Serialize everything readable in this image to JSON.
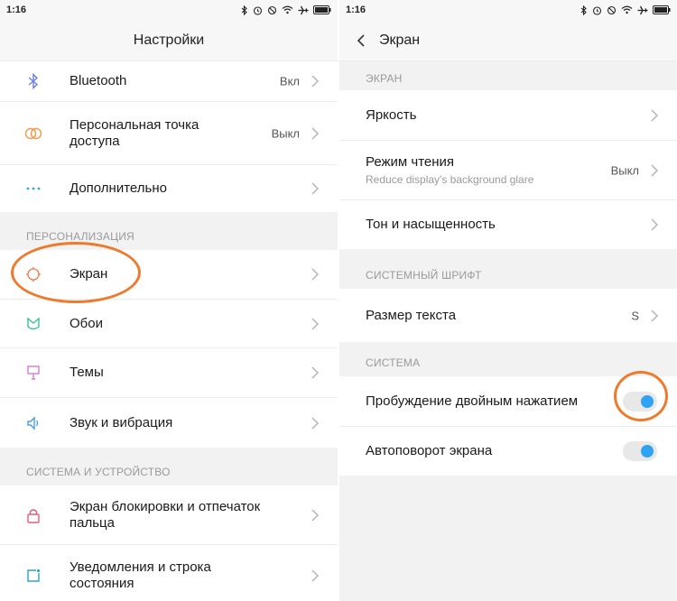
{
  "left": {
    "status_time": "1:16",
    "title": "Настройки",
    "top_rows": [
      {
        "label": "Bluetooth",
        "value": "Вкл",
        "icon": "bluetooth-icon"
      },
      {
        "label": "Персональная точка доступа",
        "value": "Выкл",
        "icon": "hotspot-icon"
      },
      {
        "label": "Дополнительно",
        "value": "",
        "icon": "more-dots-icon"
      }
    ],
    "section_personalization": "ПЕРСОНАЛИЗАЦИЯ",
    "personal_rows": [
      {
        "label": "Экран",
        "icon": "display-icon"
      },
      {
        "label": "Обои",
        "icon": "wallpaper-icon"
      },
      {
        "label": "Темы",
        "icon": "themes-icon"
      },
      {
        "label": "Звук и вибрация",
        "icon": "sound-icon"
      }
    ],
    "section_system": "СИСТЕМА И УСТРОЙСТВО",
    "system_rows": [
      {
        "label": "Экран блокировки и отпечаток пальца",
        "icon": "lock-icon"
      },
      {
        "label": "Уведомления и строка состояния",
        "icon": "notification-icon"
      }
    ]
  },
  "right": {
    "status_time": "1:16",
    "title": "Экран",
    "section_screen": "ЭКРАН",
    "screen_rows": [
      {
        "label": "Яркость",
        "sub": "",
        "value": ""
      },
      {
        "label": "Режим чтения",
        "sub": "Reduce display's background glare",
        "value": "Выкл"
      },
      {
        "label": "Тон и насыщенность",
        "sub": "",
        "value": ""
      }
    ],
    "section_font": "СИСТЕМНЫЙ ШРИФТ",
    "font_rows": [
      {
        "label": "Размер текста",
        "value": "S"
      }
    ],
    "section_system": "СИСТЕМА",
    "system_rows": [
      {
        "label": "Пробуждение двойным нажатием",
        "enabled": true
      },
      {
        "label": "Автоповорот экрана",
        "enabled": true
      }
    ]
  },
  "colors": {
    "accent_toggle": "#2ea3f2",
    "annotation": "#ee7a2e",
    "icon_tint": "#e07a55"
  }
}
